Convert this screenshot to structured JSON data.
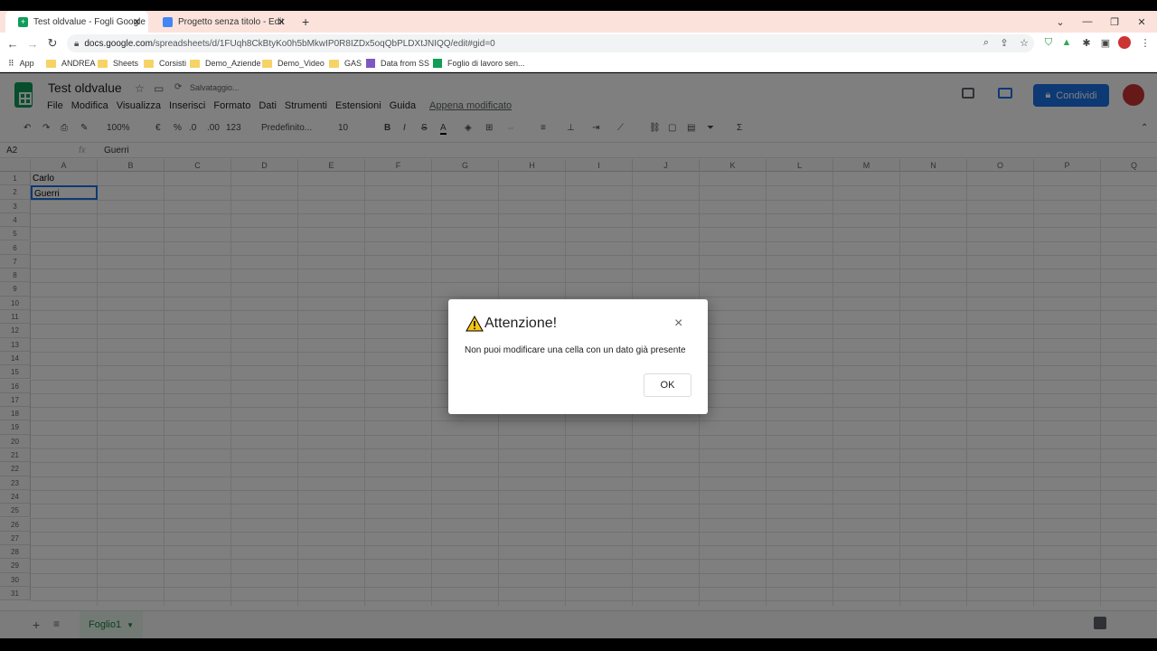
{
  "browser": {
    "tabs": [
      {
        "title": "Test oldvalue - Fogli Google",
        "active": true
      },
      {
        "title": "Progetto senza titolo - Editor pro",
        "active": false
      }
    ],
    "new_tab_label": "+",
    "url_host": "docs.google.com",
    "url_path": "/spreadsheets/d/1FUqh8CkBtyKo0h5bMkwIP0R8IZDx5oqQbPLDXtJNIQQ/edit#gid=0",
    "bookmarks": [
      "App",
      "ANDREA",
      "Sheets",
      "Corsisti",
      "Demo_Aziende",
      "Demo_Video",
      "GAS",
      "Data from SS",
      "Foglio di lavoro sen..."
    ]
  },
  "sheets": {
    "doc_title": "Test oldvalue",
    "saving_status": "Salvataggio...",
    "menu": [
      "File",
      "Modifica",
      "Visualizza",
      "Inserisci",
      "Formato",
      "Dati",
      "Strumenti",
      "Estensioni",
      "Guida"
    ],
    "last_edit": "Appena modificato",
    "share_label": "Condividi",
    "toolbar": {
      "zoom": "100%",
      "currency": "€",
      "percent": "%",
      "dec_dec": ".0",
      "dec_inc": ".00",
      "format_more": "123",
      "font": "Predefinito...",
      "font_size": "10",
      "bold": "B",
      "italic": "I",
      "strike": "S",
      "text_color": "A",
      "sum": "Σ"
    },
    "cell_ref": "A2",
    "fx": "fx",
    "formula_value": "Guerri",
    "columns": [
      "A",
      "B",
      "C",
      "D",
      "E",
      "F",
      "G",
      "H",
      "I",
      "J",
      "K",
      "L",
      "M",
      "N",
      "O",
      "P",
      "Q"
    ],
    "rows": [
      "1",
      "2",
      "3",
      "4",
      "5",
      "6",
      "7",
      "8",
      "9",
      "10",
      "11",
      "12",
      "13",
      "14",
      "15",
      "16",
      "17",
      "18",
      "19",
      "20",
      "21",
      "22",
      "23",
      "24",
      "25",
      "26",
      "27",
      "28",
      "29",
      "30",
      "31"
    ],
    "cells": {
      "A1": "Carlo",
      "A2": "Guerri"
    },
    "sheet_tab": "Foglio1"
  },
  "dialog": {
    "title": "Attenzione!",
    "message": "Non puoi modificare una cella con un dato già presente",
    "ok_label": "OK",
    "close_symbol": "×"
  },
  "colors": {
    "accent": "#1a73e8",
    "sheets_green": "#0f9d58",
    "warning": "#f5c518"
  }
}
